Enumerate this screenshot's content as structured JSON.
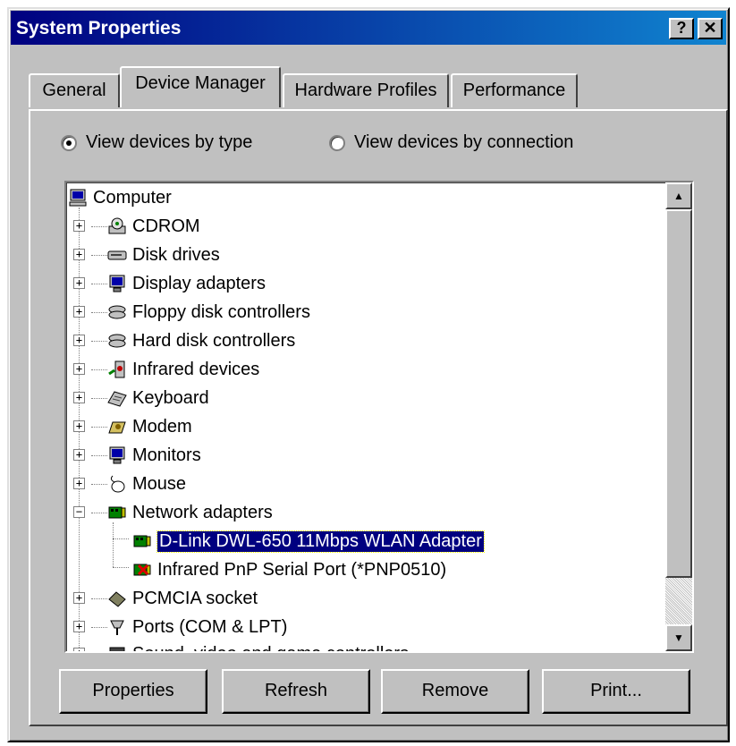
{
  "window": {
    "title": "System Properties",
    "help_button": "?",
    "close_button": "✕"
  },
  "tabs": [
    {
      "label": "General",
      "active": false
    },
    {
      "label": "Device Manager",
      "active": true
    },
    {
      "label": "Hardware Profiles",
      "active": false
    },
    {
      "label": "Performance",
      "active": false
    }
  ],
  "view_options": {
    "by_type": {
      "label": "View devices by type",
      "selected": true
    },
    "by_connection": {
      "label": "View devices by connection",
      "selected": false
    }
  },
  "device_tree": {
    "root": {
      "label": "Computer",
      "icon": "computer-icon"
    },
    "items": [
      {
        "label": "CDROM",
        "icon": "cdrom-icon",
        "expanded": false
      },
      {
        "label": "Disk drives",
        "icon": "disk-drive-icon",
        "expanded": false
      },
      {
        "label": "Display adapters",
        "icon": "display-adapter-icon",
        "expanded": false
      },
      {
        "label": "Floppy disk controllers",
        "icon": "floppy-controller-icon",
        "expanded": false
      },
      {
        "label": "Hard disk controllers",
        "icon": "hard-disk-controller-icon",
        "expanded": false
      },
      {
        "label": "Infrared devices",
        "icon": "infrared-icon",
        "expanded": false
      },
      {
        "label": "Keyboard",
        "icon": "keyboard-icon",
        "expanded": false
      },
      {
        "label": "Modem",
        "icon": "modem-icon",
        "expanded": false
      },
      {
        "label": "Monitors",
        "icon": "monitor-icon",
        "expanded": false
      },
      {
        "label": "Mouse",
        "icon": "mouse-icon",
        "expanded": false
      },
      {
        "label": "Network adapters",
        "icon": "network-adapter-icon",
        "expanded": true,
        "children": [
          {
            "label": "D-Link DWL-650 11Mbps WLAN Adapter",
            "icon": "network-card-icon",
            "selected": true
          },
          {
            "label": "Infrared PnP Serial Port (*PNP0510)",
            "icon": "network-card-error-icon",
            "selected": false
          }
        ]
      },
      {
        "label": "PCMCIA socket",
        "icon": "pcmcia-icon",
        "expanded": false
      },
      {
        "label": "Ports (COM & LPT)",
        "icon": "port-icon",
        "expanded": false
      },
      {
        "label": "Sound, video and game controllers",
        "icon": "sound-icon",
        "expanded": false
      }
    ]
  },
  "buttons": {
    "properties": "Properties",
    "refresh": "Refresh",
    "remove": "Remove",
    "print": "Print..."
  },
  "colors": {
    "face": "#c0c0c0",
    "titlebar_start": "#000080",
    "titlebar_end": "#1084d0",
    "selection": "#000080"
  }
}
